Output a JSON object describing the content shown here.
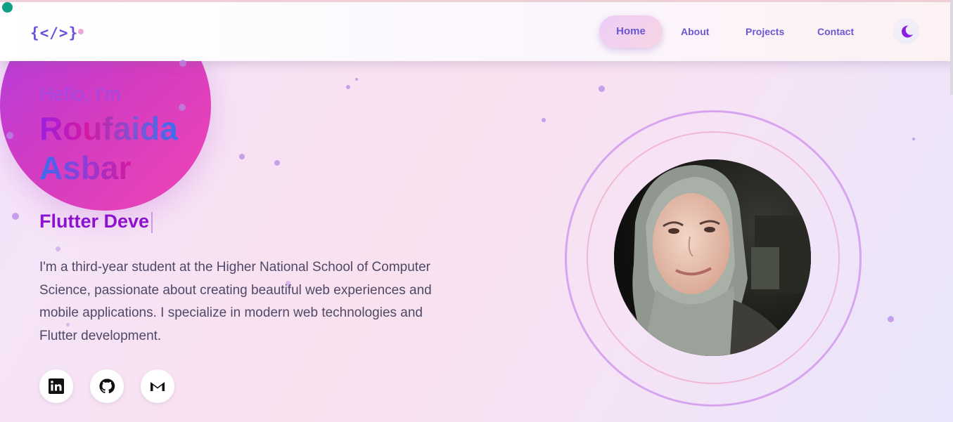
{
  "nav": {
    "logo": "{</>}",
    "items": [
      {
        "label": "Home",
        "active": true
      },
      {
        "label": "About"
      },
      {
        "label": "Projects"
      },
      {
        "label": "Contact"
      }
    ],
    "theme_icon": "moon-icon"
  },
  "hero": {
    "greeting": "Hello, I'm",
    "first_name": "Roufaida",
    "last_name": "Asbar",
    "role_typed": "Flutter Deve",
    "bio": "I'm a third-year student at the Higher National School of Computer Science, passionate about creating beautiful web experiences and mobile applications. I specialize in modern web technologies and Flutter development.",
    "social": [
      {
        "icon": "linkedin-icon"
      },
      {
        "icon": "github-icon"
      },
      {
        "icon": "gmail-icon"
      }
    ]
  },
  "colors": {
    "accent_purple": "#8d12d0",
    "accent_pink": "#d419a0",
    "accent_blue": "#3a6ff0",
    "nav_text": "#6a58cf"
  }
}
